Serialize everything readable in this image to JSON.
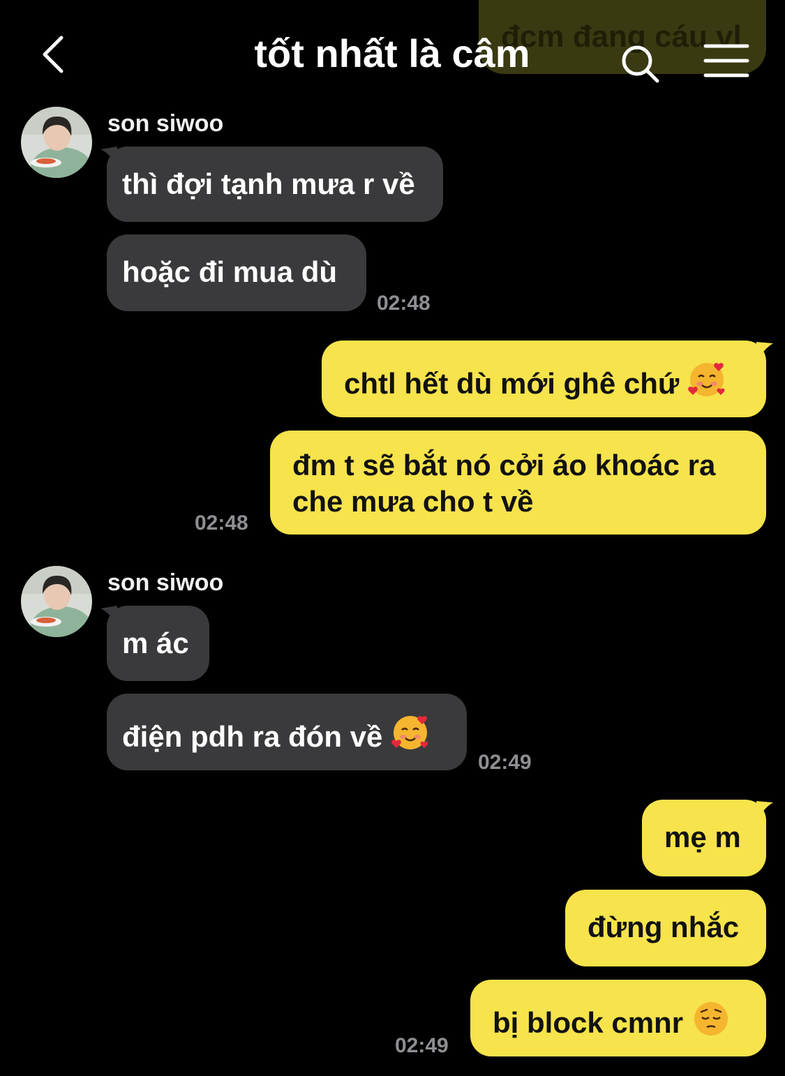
{
  "header": {
    "title": "tốt nhất là câm",
    "behind_message": "đcm đang cáu vl",
    "back_icon": "chevron-left-icon",
    "search_icon": "search-icon",
    "menu_icon": "menu-icon"
  },
  "contact": {
    "name": "son siwoo"
  },
  "colors": {
    "background": "#000000",
    "incoming_bubble": "#3a3a3c",
    "outgoing_bubble": "#f7e34b",
    "timestamp": "#8e8e93"
  },
  "messages": {
    "group1": {
      "sender": "son siwoo",
      "m1": "thì đợi tạnh mưa r về",
      "m2": "hoặc đi mua dù",
      "time": "02:48"
    },
    "group2": {
      "m1": "chtl hết dù mới ghê chứ",
      "m2": "đm t sẽ bắt nó cởi áo khoác ra che mưa cho t về",
      "time": "02:48"
    },
    "group3": {
      "sender": "son siwoo",
      "m1": "m ác",
      "m2": "điện pdh ra đón về",
      "time": "02:49"
    },
    "group4": {
      "m1": "mẹ m",
      "m2": "đừng nhắc",
      "m3": "bị block cmnr",
      "time": "02:49"
    }
  },
  "emoji_icons": [
    "smiling-face-with-hearts-icon",
    "pensive-face-icon"
  ]
}
